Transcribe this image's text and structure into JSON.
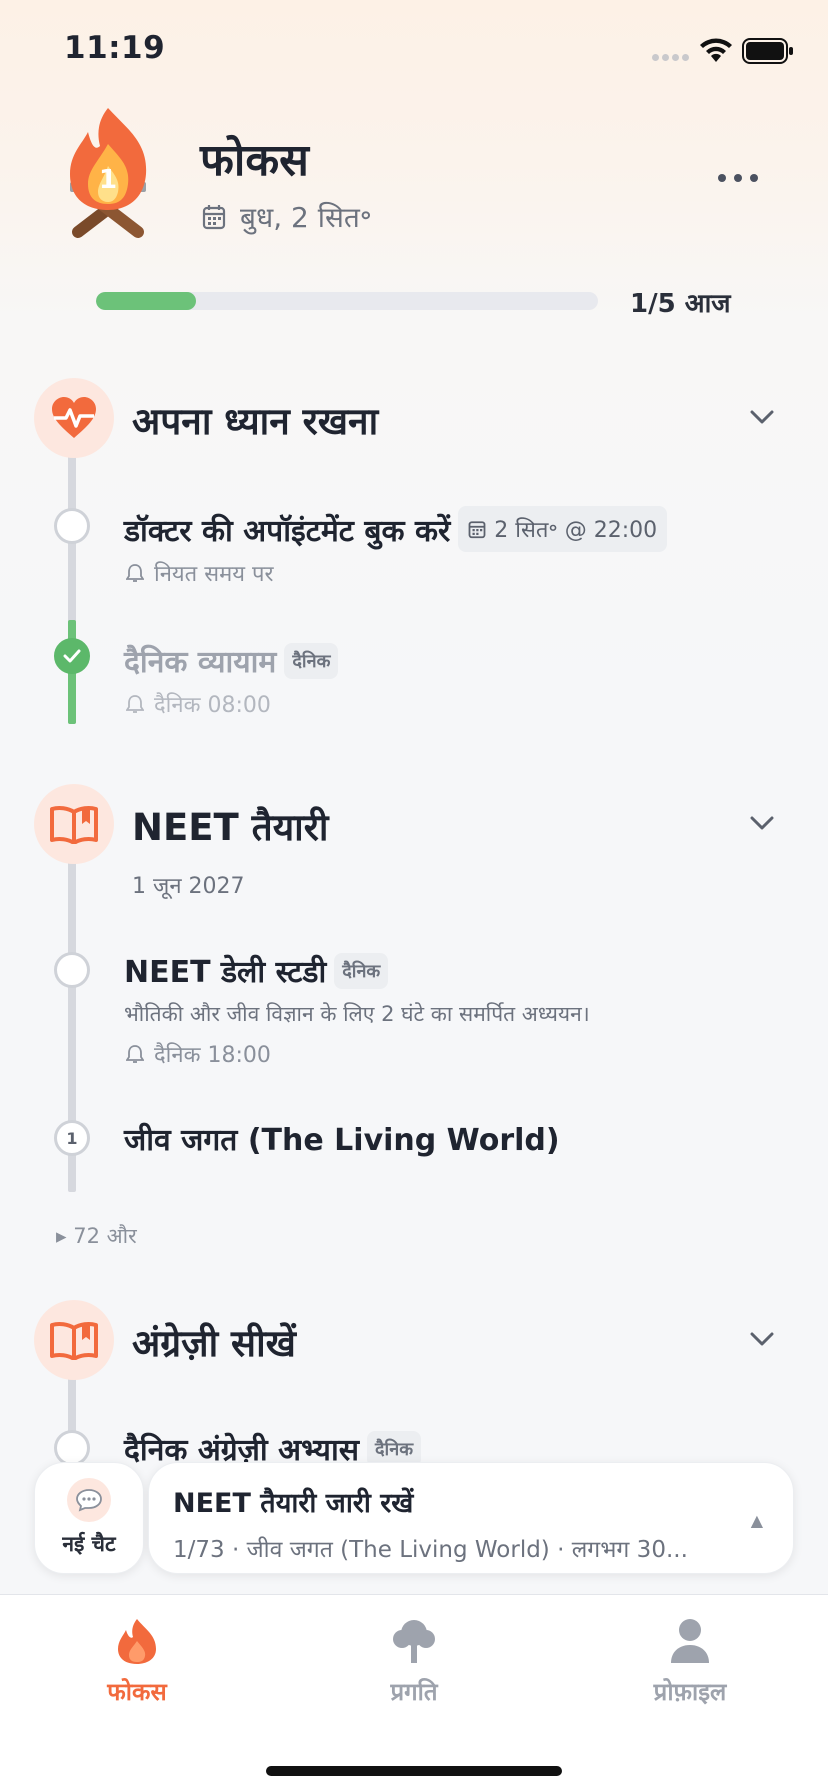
{
  "status_bar": {
    "time": "11:19"
  },
  "header": {
    "title": "फोकस",
    "date": "बुध, 2 सित॰",
    "progress_fraction": 0.2,
    "progress_label": "1/5 आज",
    "mascot_badge": "1"
  },
  "categories": [
    {
      "title": "अपना ध्यान रखना",
      "icon": "heartbeat-icon",
      "tasks": [
        {
          "title": "डॉक्टर की अपॉइंटमेंट बुक करें",
          "date_chip": "2 सित॰ @ 22:00",
          "reminder": "नियत समय पर",
          "done": false
        },
        {
          "title": "दैनिक व्यायाम",
          "chip": "दैनिक",
          "reminder": "दैनिक 08:00",
          "done": true
        }
      ]
    },
    {
      "title": "NEET तैयारी",
      "icon": "open-book-icon",
      "deadline": "1 जून 2027",
      "tasks": [
        {
          "title": "NEET डेली स्टडी",
          "chip": "दैनिक",
          "description": "भौतिकी और जीव विज्ञान के लिए 2 घंटे का समर्पित अध्ययन।",
          "reminder": "दैनिक 18:00",
          "done": false
        },
        {
          "title": "जीव जगत (The Living World)",
          "number": "1",
          "done": false
        }
      ],
      "more_label": "▸ 72 और"
    },
    {
      "title": "अंग्रेज़ी सीखें",
      "icon": "open-book-icon",
      "tasks": [
        {
          "title": "दैनिक अंग्रेज़ी अभ्यास",
          "chip": "दैनिक",
          "done": false
        }
      ]
    }
  ],
  "bottom_bar": {
    "new_chat_label": "नई चैट",
    "continue_title": "NEET तैयारी जारी रखें",
    "continue_subtitle": "1/73 · जीव जगत (The Living World) · लगभग 30..."
  },
  "tabs": [
    {
      "label": "फोकस",
      "icon": "flame-icon",
      "active": true
    },
    {
      "label": "प्रगति",
      "icon": "tree-icon",
      "active": false
    },
    {
      "label": "प्रोफ़ाइल",
      "icon": "person-icon",
      "active": false
    }
  ],
  "colors": {
    "accent": "#f26a3d",
    "progress": "#6cc279",
    "done": "#5cb86a"
  }
}
